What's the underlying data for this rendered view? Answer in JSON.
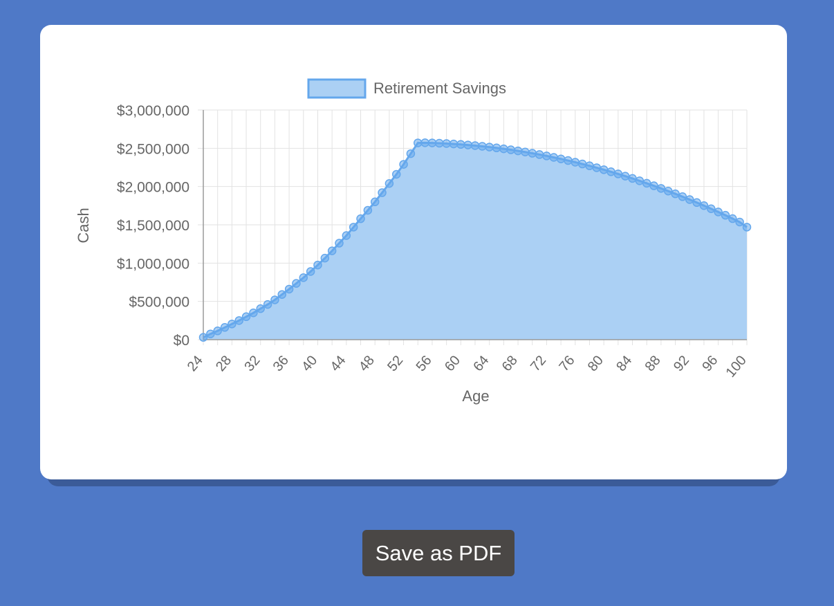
{
  "colors": {
    "background": "#4f79c7",
    "card": "#ffffff",
    "series_fill": "#abd0f4",
    "series_line": "#64a7ec",
    "button": "#4a4745"
  },
  "chart_data": {
    "type": "area",
    "xlabel": "Age",
    "ylabel": "Cash",
    "xlim": [
      24,
      100
    ],
    "ylim": [
      0,
      3000000
    ],
    "x_ticks": [
      "24",
      "28",
      "32",
      "36",
      "40",
      "44",
      "48",
      "52",
      "56",
      "60",
      "64",
      "68",
      "72",
      "76",
      "80",
      "84",
      "88",
      "92",
      "96",
      "100"
    ],
    "y_ticks": [
      "$0",
      "$500,000",
      "$1,000,000",
      "$1,500,000",
      "$2,000,000",
      "$2,500,000",
      "$3,000,000"
    ],
    "grid": true,
    "legend": "top",
    "series": [
      {
        "name": "Retirement Savings",
        "x": [
          24,
          25,
          26,
          27,
          28,
          29,
          30,
          31,
          32,
          33,
          34,
          35,
          36,
          37,
          38,
          39,
          40,
          41,
          42,
          43,
          44,
          45,
          46,
          47,
          48,
          49,
          50,
          51,
          52,
          53,
          54,
          55,
          56,
          57,
          58,
          59,
          60,
          61,
          62,
          63,
          64,
          65,
          66,
          67,
          68,
          69,
          70,
          71,
          72,
          73,
          74,
          75,
          76,
          77,
          78,
          79,
          80,
          81,
          82,
          83,
          84,
          85,
          86,
          87,
          88,
          89,
          90,
          91,
          92,
          93,
          94,
          95,
          96,
          97,
          98,
          99,
          100
        ],
        "values": [
          30000,
          75000,
          115000,
          160000,
          205000,
          250000,
          300000,
          350000,
          405000,
          460000,
          520000,
          590000,
          660000,
          735000,
          810000,
          890000,
          975000,
          1065000,
          1160000,
          1260000,
          1360000,
          1470000,
          1580000,
          1690000,
          1800000,
          1920000,
          2040000,
          2160000,
          2290000,
          2430000,
          2570000,
          2572000,
          2570000,
          2566000,
          2562000,
          2556000,
          2550000,
          2543000,
          2535000,
          2526000,
          2516000,
          2505000,
          2493000,
          2480000,
          2466000,
          2451000,
          2435000,
          2418000,
          2400000,
          2381000,
          2361000,
          2340000,
          2318000,
          2295000,
          2271000,
          2246000,
          2220000,
          2193000,
          2165000,
          2136000,
          2106000,
          2075000,
          2043000,
          2010000,
          1976000,
          1941000,
          1905000,
          1868000,
          1830000,
          1791000,
          1751000,
          1710000,
          1668000,
          1625000,
          1581000,
          1536000,
          1470000
        ]
      }
    ]
  },
  "actions": {
    "save_pdf_label": "Save as PDF"
  }
}
